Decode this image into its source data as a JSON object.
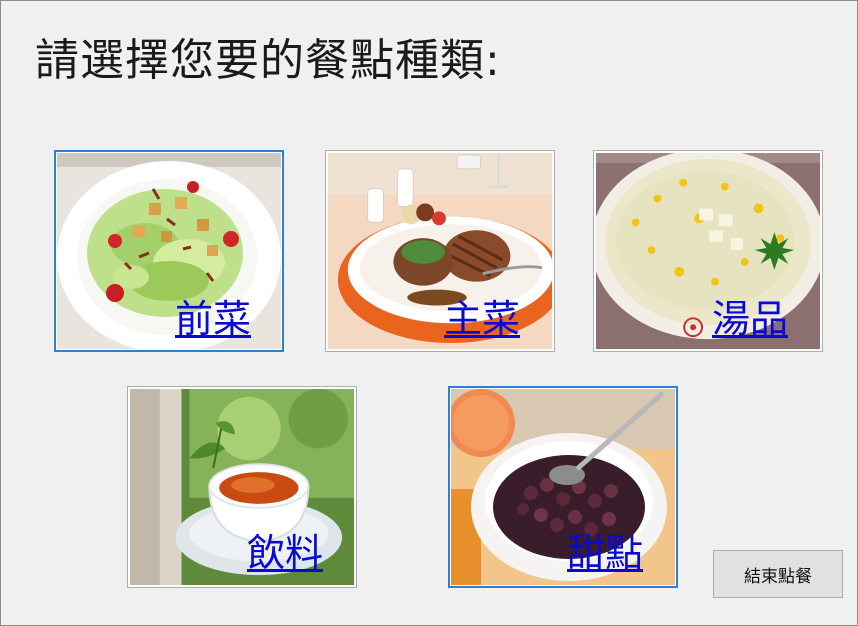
{
  "page": {
    "title": "請選擇您要的餐點種類:"
  },
  "categories": [
    {
      "label": "前菜",
      "icon": "salad-image"
    },
    {
      "label": "主菜",
      "icon": "steak-image"
    },
    {
      "label": "湯品",
      "icon": "corn-soup-image"
    },
    {
      "label": "飲料",
      "icon": "tea-image"
    },
    {
      "label": "甜點",
      "icon": "red-bean-dessert-image"
    }
  ],
  "buttons": {
    "end_order": "結束點餐"
  },
  "colors": {
    "link": "#0a0ad6",
    "focus_border": "#2f7fd4",
    "window_background": "#f0f0f0"
  }
}
